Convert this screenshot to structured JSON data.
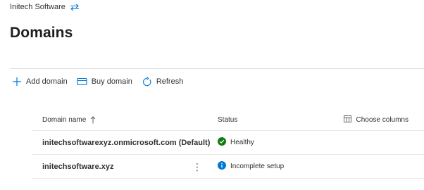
{
  "org": {
    "name": "Initech Software"
  },
  "page": {
    "title": "Domains"
  },
  "toolbar": {
    "add_label": "Add domain",
    "buy_label": "Buy domain",
    "refresh_label": "Refresh"
  },
  "table": {
    "columns": {
      "name": "Domain name",
      "status": "Status",
      "choose_columns": "Choose columns"
    },
    "sort": {
      "column": "name",
      "direction": "ascending"
    },
    "rows": [
      {
        "name": "initechsoftwarexyz.onmicrosoft.com (Default)",
        "status": "Healthy",
        "status_icon": "check-circle-icon"
      },
      {
        "name": "initechsoftware.xyz",
        "status": "Incomplete setup",
        "status_icon": "info-circle-icon"
      }
    ]
  },
  "colors": {
    "accent": "#0078d4",
    "healthy": "#107c10",
    "info": "#0078d4",
    "text": "#323130",
    "divider": "#e1dfdd"
  }
}
